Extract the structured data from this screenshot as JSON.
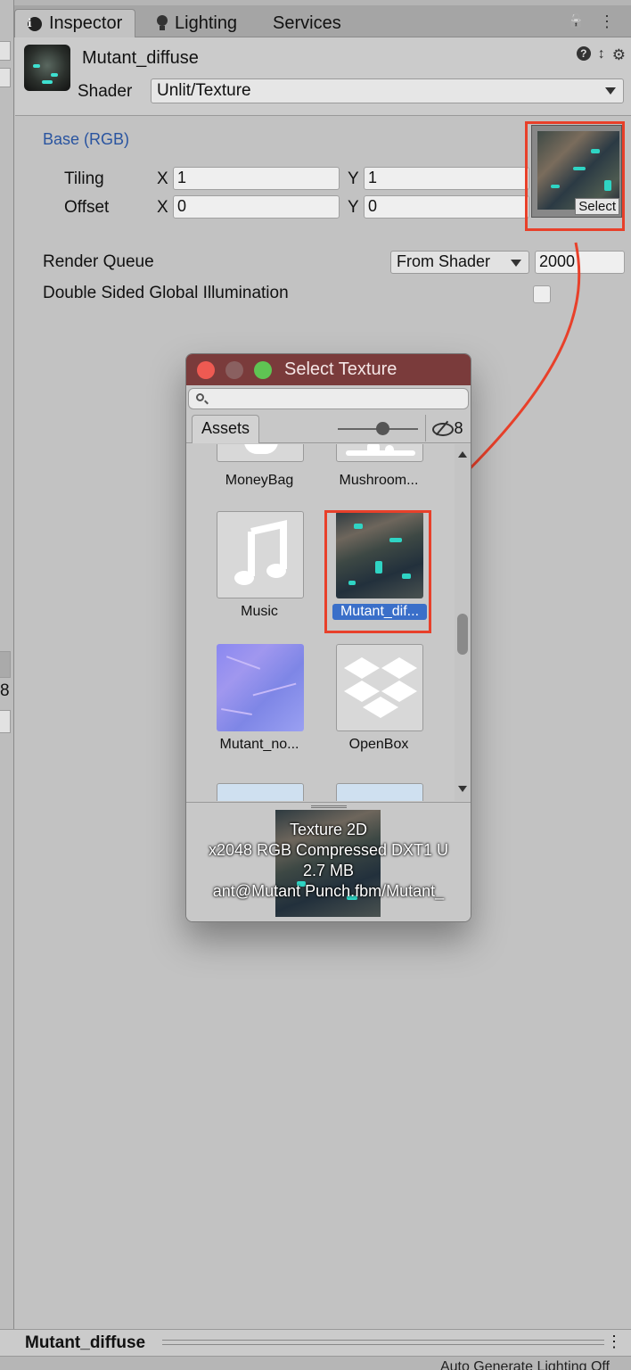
{
  "tabs": [
    {
      "label": "Inspector",
      "icon": "info-icon"
    },
    {
      "label": "Lighting",
      "icon": "bulb-icon"
    },
    {
      "label": "Services"
    }
  ],
  "tabbar_icons": {
    "lock": "🔓",
    "menu": "⋮"
  },
  "left_strip": {
    "value": "8"
  },
  "material": {
    "name": "Mutant_diffuse",
    "shader_label": "Shader",
    "shader_value": "Unlit/Texture",
    "help_icon": "?",
    "settings_icon": "⚙"
  },
  "properties": {
    "base_title": "Base (RGB)",
    "tiling_label": "Tiling",
    "offset_label": "Offset",
    "x_label": "X",
    "y_label": "Y",
    "tiling_x": "1",
    "tiling_y": "1",
    "offset_x": "0",
    "offset_y": "0",
    "select_label": "Select",
    "render_queue_label": "Render Queue",
    "render_queue_mode": "From Shader",
    "render_queue_value": "2000",
    "dsgi_label": "Double Sided Global Illumination"
  },
  "dialog": {
    "title": "Select Texture",
    "search_placeholder": "",
    "tab_assets": "Assets",
    "hidden_count": "8",
    "slider_level": 0.55,
    "items": [
      {
        "caption": "MoneyBag",
        "selected": false
      },
      {
        "caption": "Mushroom...",
        "selected": false
      },
      {
        "caption": "Music",
        "selected": false,
        "icon": "music-note-icon"
      },
      {
        "caption": "Mutant_dif...",
        "selected": true
      },
      {
        "caption": "Mutant_no...",
        "selected": false
      },
      {
        "caption": "OpenBox",
        "selected": false,
        "icon": "dropbox-icon"
      }
    ],
    "preview": {
      "type": "Texture 2D",
      "format": "x2048  RGB Compressed DXT1 U",
      "size": "2.7 MB",
      "path": "ant@Mutant Punch.fbm/Mutant_"
    }
  },
  "bottom": {
    "name": "Mutant_diffuse",
    "status": "Auto Generate Lighting Off"
  },
  "colors": {
    "accent_red": "#e8402a",
    "selection_blue": "#3a6fc9",
    "title_blue": "#2954a0",
    "dialog_titlebar": "#7a3b3b"
  }
}
